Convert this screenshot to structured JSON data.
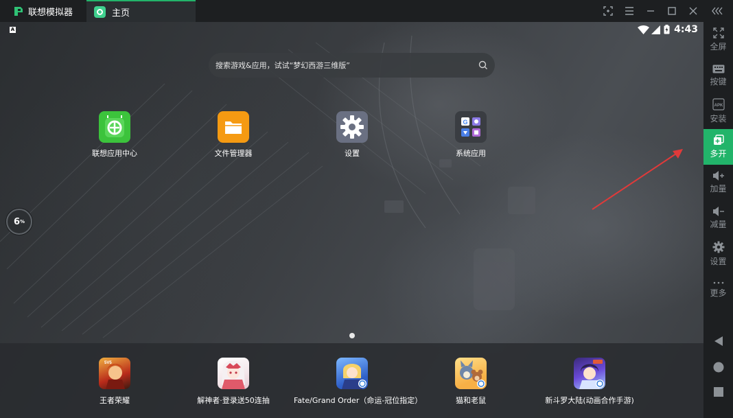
{
  "window": {
    "app_name": "联想模拟器",
    "tab_label": "主页"
  },
  "status": {
    "time": "4:43",
    "indicator": "A"
  },
  "search": {
    "placeholder": "搜索游戏&应用，试试“梦幻西游三维版”"
  },
  "apps": [
    {
      "label": "联想应用中心",
      "icon": "lenovo-app-center-icon",
      "color": "#3cc33c"
    },
    {
      "label": "文件管理器",
      "icon": "folder-icon",
      "color": "#f59a12"
    },
    {
      "label": "设置",
      "icon": "gear-icon",
      "color": "#6a7082"
    },
    {
      "label": "系统应用",
      "icon": "app-folder-icon",
      "color": "#3a3d42"
    }
  ],
  "dock": [
    {
      "label": "王者荣耀",
      "icon": "honor-of-kings-icon"
    },
    {
      "label": "解神者·登录送50连抽",
      "icon": "xeno-icon"
    },
    {
      "label": "Fate/Grand Order（命运-冠位指定）",
      "icon": "fgo-icon"
    },
    {
      "label": "猫和老鼠",
      "icon": "tom-and-jerry-icon"
    },
    {
      "label": "新斗罗大陆(动画合作手游)",
      "icon": "douluo-icon"
    }
  ],
  "perf": {
    "value": "6",
    "unit": "%"
  },
  "sidebar": {
    "items": [
      {
        "label": "全屏",
        "icon": "fullscreen-icon"
      },
      {
        "label": "按键",
        "icon": "keyboard-icon"
      },
      {
        "label": "安装",
        "icon": "apk-install-icon"
      },
      {
        "label": "多开",
        "icon": "multi-instance-icon"
      },
      {
        "label": "加量",
        "icon": "volume-up-icon"
      },
      {
        "label": "减量",
        "icon": "volume-down-icon"
      },
      {
        "label": "设置",
        "icon": "gear-icon"
      },
      {
        "label": "更多",
        "icon": "more-icon"
      }
    ],
    "active_index": 3
  },
  "colors": {
    "accent": "#22b46a",
    "annotation_arrow": "#e03a3a"
  }
}
